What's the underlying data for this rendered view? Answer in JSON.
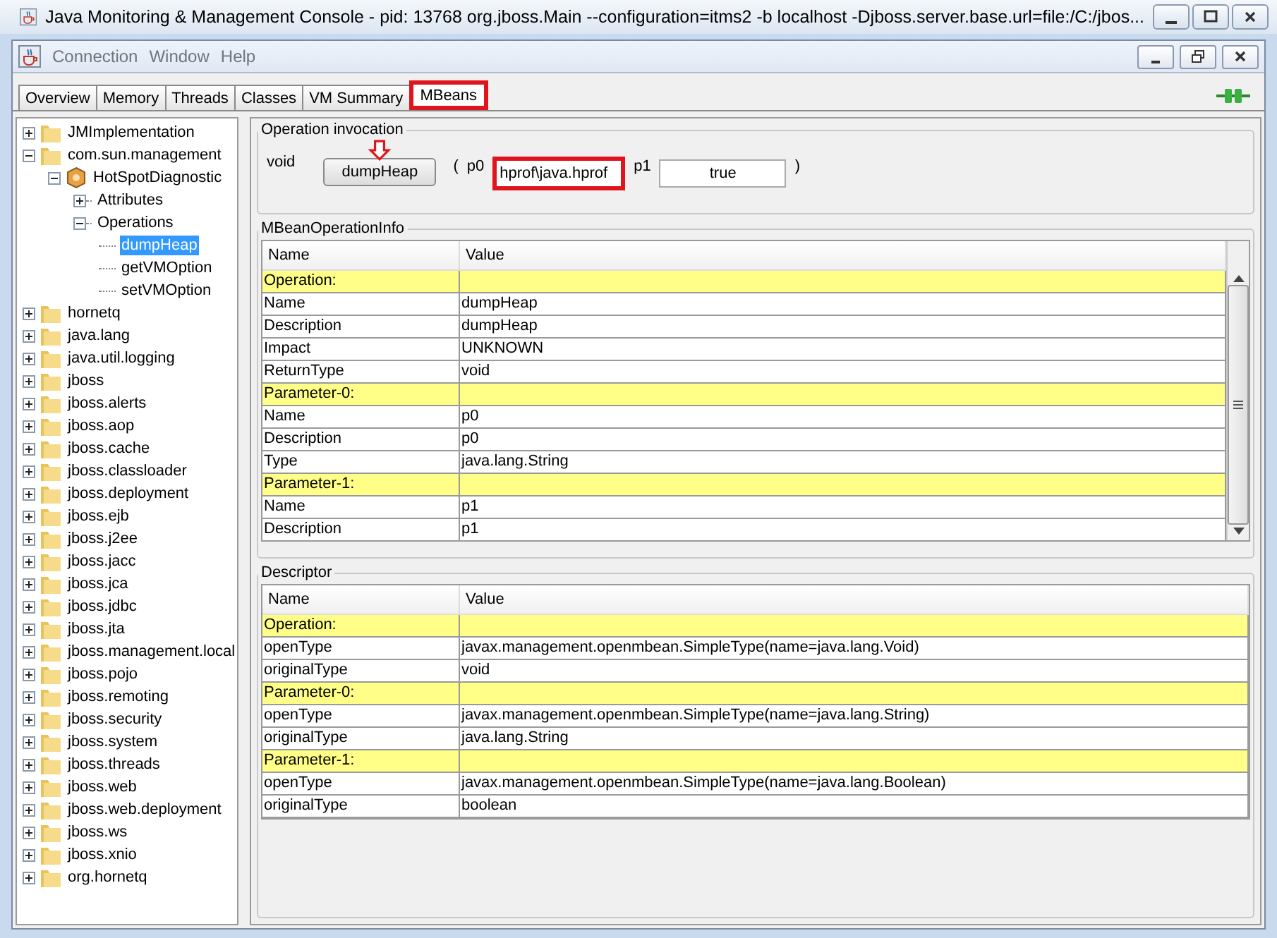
{
  "window": {
    "title": "Java Monitoring & Management Console - pid: 13768 org.jboss.Main --configuration=itms2 -b localhost -Djboss.server.base.url=file:/C:/jbos..."
  },
  "menu": [
    "Connection",
    "Window",
    "Help"
  ],
  "tabs": [
    {
      "label": "Overview",
      "selected": false,
      "highlighted": false
    },
    {
      "label": "Memory",
      "selected": false,
      "highlighted": false
    },
    {
      "label": "Threads",
      "selected": false,
      "highlighted": false
    },
    {
      "label": "Classes",
      "selected": false,
      "highlighted": false
    },
    {
      "label": "VM Summary",
      "selected": false,
      "highlighted": false
    },
    {
      "label": "MBeans",
      "selected": true,
      "highlighted": true
    }
  ],
  "tree": [
    {
      "label": "JMImplementation",
      "kind": "folder",
      "expanded": false,
      "selected": false
    },
    {
      "label": "com.sun.management",
      "kind": "folder",
      "expanded": true,
      "selected": false,
      "children": [
        {
          "label": "HotSpotDiagnostic",
          "kind": "bean",
          "expanded": true,
          "selected": false,
          "children": [
            {
              "label": "Attributes",
              "kind": "node",
              "expanded": false,
              "selected": false
            },
            {
              "label": "Operations",
              "kind": "node",
              "expanded": true,
              "selected": false,
              "children": [
                {
                  "label": "dumpHeap",
                  "kind": "leaf",
                  "selected": true
                },
                {
                  "label": "getVMOption",
                  "kind": "leaf",
                  "selected": false
                },
                {
                  "label": "setVMOption",
                  "kind": "leaf",
                  "selected": false
                }
              ]
            }
          ]
        }
      ]
    },
    {
      "label": "hornetq",
      "kind": "folder",
      "expanded": false,
      "selected": false
    },
    {
      "label": "java.lang",
      "kind": "folder",
      "expanded": false,
      "selected": false
    },
    {
      "label": "java.util.logging",
      "kind": "folder",
      "expanded": false,
      "selected": false
    },
    {
      "label": "jboss",
      "kind": "folder",
      "expanded": false,
      "selected": false
    },
    {
      "label": "jboss.alerts",
      "kind": "folder",
      "expanded": false,
      "selected": false
    },
    {
      "label": "jboss.aop",
      "kind": "folder",
      "expanded": false,
      "selected": false
    },
    {
      "label": "jboss.cache",
      "kind": "folder",
      "expanded": false,
      "selected": false
    },
    {
      "label": "jboss.classloader",
      "kind": "folder",
      "expanded": false,
      "selected": false
    },
    {
      "label": "jboss.deployment",
      "kind": "folder",
      "expanded": false,
      "selected": false
    },
    {
      "label": "jboss.ejb",
      "kind": "folder",
      "expanded": false,
      "selected": false
    },
    {
      "label": "jboss.j2ee",
      "kind": "folder",
      "expanded": false,
      "selected": false
    },
    {
      "label": "jboss.jacc",
      "kind": "folder",
      "expanded": false,
      "selected": false
    },
    {
      "label": "jboss.jca",
      "kind": "folder",
      "expanded": false,
      "selected": false
    },
    {
      "label": "jboss.jdbc",
      "kind": "folder",
      "expanded": false,
      "selected": false
    },
    {
      "label": "jboss.jta",
      "kind": "folder",
      "expanded": false,
      "selected": false
    },
    {
      "label": "jboss.management.local",
      "kind": "folder",
      "expanded": false,
      "selected": false
    },
    {
      "label": "jboss.pojo",
      "kind": "folder",
      "expanded": false,
      "selected": false
    },
    {
      "label": "jboss.remoting",
      "kind": "folder",
      "expanded": false,
      "selected": false
    },
    {
      "label": "jboss.security",
      "kind": "folder",
      "expanded": false,
      "selected": false
    },
    {
      "label": "jboss.system",
      "kind": "folder",
      "expanded": false,
      "selected": false
    },
    {
      "label": "jboss.threads",
      "kind": "folder",
      "expanded": false,
      "selected": false
    },
    {
      "label": "jboss.web",
      "kind": "folder",
      "expanded": false,
      "selected": false
    },
    {
      "label": "jboss.web.deployment",
      "kind": "folder",
      "expanded": false,
      "selected": false
    },
    {
      "label": "jboss.ws",
      "kind": "folder",
      "expanded": false,
      "selected": false
    },
    {
      "label": "jboss.xnio",
      "kind": "folder",
      "expanded": false,
      "selected": false
    },
    {
      "label": "org.hornetq",
      "kind": "folder",
      "expanded": false,
      "selected": false
    }
  ],
  "invocation": {
    "title": "Operation invocation",
    "return_type": "void",
    "button": "dumpHeap",
    "open_paren": "(",
    "params": [
      {
        "label": "p0",
        "value": "hprof\\java.hprof",
        "highlighted": true
      },
      {
        "label": "p1",
        "value": "true",
        "highlighted": false
      }
    ],
    "close_paren": ")"
  },
  "operation_info": {
    "title": "MBeanOperationInfo",
    "columns": [
      "Name",
      "Value"
    ],
    "rows": [
      {
        "kind": "header",
        "name": "Operation:",
        "value": ""
      },
      {
        "kind": "row",
        "name": "Name",
        "value": "dumpHeap"
      },
      {
        "kind": "row",
        "name": "Description",
        "value": "dumpHeap"
      },
      {
        "kind": "row",
        "name": "Impact",
        "value": "UNKNOWN"
      },
      {
        "kind": "row",
        "name": "ReturnType",
        "value": "void"
      },
      {
        "kind": "header",
        "name": "Parameter-0:",
        "value": ""
      },
      {
        "kind": "row",
        "name": "Name",
        "value": "p0"
      },
      {
        "kind": "row",
        "name": "Description",
        "value": "p0"
      },
      {
        "kind": "row",
        "name": "Type",
        "value": "java.lang.String"
      },
      {
        "kind": "header",
        "name": "Parameter-1:",
        "value": ""
      },
      {
        "kind": "row",
        "name": "Name",
        "value": "p1"
      },
      {
        "kind": "row",
        "name": "Description",
        "value": "p1"
      }
    ]
  },
  "descriptor": {
    "title": "Descriptor",
    "columns": [
      "Name",
      "Value"
    ],
    "rows": [
      {
        "kind": "header",
        "name": "Operation:",
        "value": ""
      },
      {
        "kind": "row",
        "name": "openType",
        "value": "javax.management.openmbean.SimpleType(name=java.lang.Void)"
      },
      {
        "kind": "row",
        "name": "originalType",
        "value": "void"
      },
      {
        "kind": "header",
        "name": "Parameter-0:",
        "value": ""
      },
      {
        "kind": "row",
        "name": "openType",
        "value": "javax.management.openmbean.SimpleType(name=java.lang.String)"
      },
      {
        "kind": "row",
        "name": "originalType",
        "value": "java.lang.String"
      },
      {
        "kind": "header",
        "name": "Parameter-1:",
        "value": ""
      },
      {
        "kind": "row",
        "name": "openType",
        "value": "javax.management.openmbean.SimpleType(name=java.lang.Boolean)"
      },
      {
        "kind": "row",
        "name": "originalType",
        "value": "boolean"
      }
    ]
  }
}
